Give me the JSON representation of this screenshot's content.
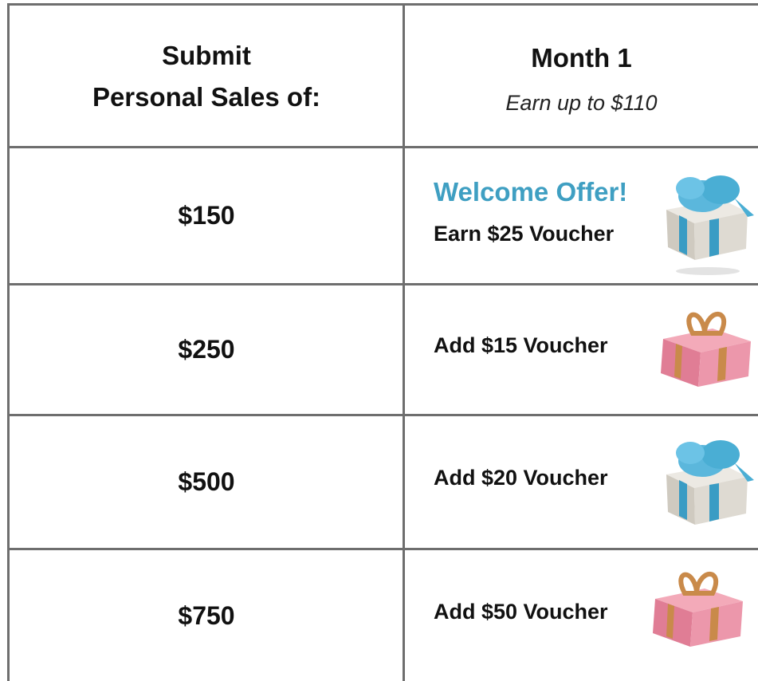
{
  "header": {
    "left_line1": "Submit",
    "left_line2": "Personal Sales of:",
    "month_title": "Month 1",
    "month_subtitle": "Earn up to $110"
  },
  "rows": [
    {
      "amount": "$150",
      "offer_title": "Welcome Offer!",
      "reward": "Earn $25 Voucher",
      "gift_icon": "blue-gift-icon"
    },
    {
      "amount": "$250",
      "reward": "Add $15 Voucher",
      "gift_icon": "pink-gift-icon"
    },
    {
      "amount": "$500",
      "reward": "Add $20 Voucher",
      "gift_icon": "blue-gift-icon"
    },
    {
      "amount": "$750",
      "reward": "Add $50 Voucher",
      "gift_icon": "pink-gift-icon"
    }
  ],
  "colors": {
    "grid": "#6e6e6e",
    "welcome": "#3f9fc2",
    "blue_ribbon": "#4aaed4",
    "pink_box": "#e88fa6",
    "gold_ribbon": "#c98a4a",
    "grey_box": "#d9d6cf"
  }
}
